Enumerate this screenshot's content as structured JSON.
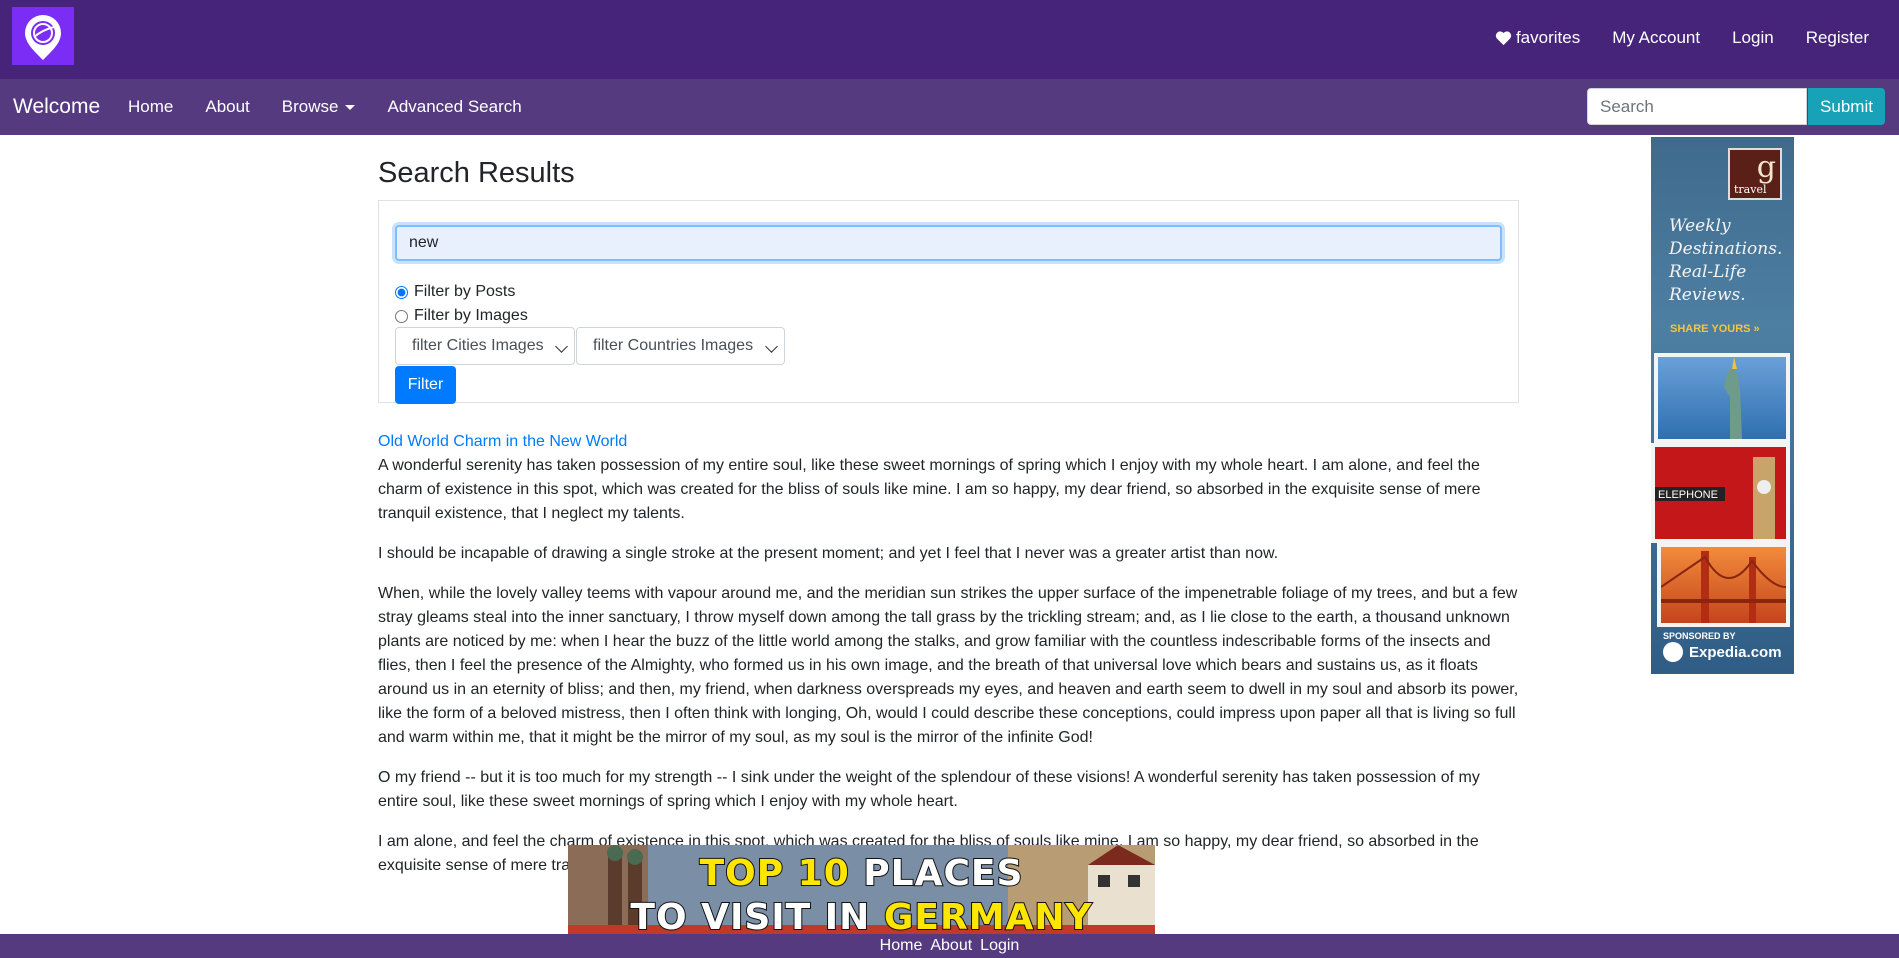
{
  "header": {
    "links": [
      {
        "label": "favorites",
        "icon": "heart-icon"
      },
      {
        "label": "My Account"
      },
      {
        "label": "Login"
      },
      {
        "label": "Register"
      }
    ]
  },
  "navbar": {
    "brand": "Welcome",
    "items": [
      "Home",
      "About",
      "Browse",
      "Advanced Search"
    ],
    "search_placeholder": "Search",
    "submit_label": "Submit"
  },
  "main": {
    "title": "Search Results",
    "query": "new",
    "filters": {
      "posts_label": "Filter by Posts",
      "images_label": "Filter by Images",
      "selected": "posts",
      "cities_select": "filter Cities Images",
      "countries_select": "filter Countries Images",
      "button": "Filter"
    },
    "result": {
      "title": "Old World Charm in the New World",
      "paragraphs": [
        "A wonderful serenity has taken possession of my entire soul, like these sweet mornings of spring which I enjoy with my whole heart. I am alone, and feel the charm of existence in this spot, which was created for the bliss of souls like mine. I am so happy, my dear friend, so absorbed in the exquisite sense of mere tranquil existence, that I neglect my talents.",
        "I should be incapable of drawing a single stroke at the present moment; and yet I feel that I never was a greater artist than now.",
        "When, while the lovely valley teems with vapour around me, and the meridian sun strikes the upper surface of the impenetrable foliage of my trees, and but a few stray gleams steal into the inner sanctuary, I throw myself down among the tall grass by the trickling stream; and, as I lie close to the earth, a thousand unknown plants are noticed by me: when I hear the buzz of the little world among the stalks, and grow familiar with the countless indescribable forms of the insects and flies, then I feel the presence of the Almighty, who formed us in his own image, and the breath of that universal love which bears and sustains us, as it floats around us in an eternity of bliss; and then, my friend, when darkness overspreads my eyes, and heaven and earth seem to dwell in my soul and absorb its power, like the form of a beloved mistress, then I often think with longing, Oh, would I could describe these conceptions, could impress upon paper all that is living so full and warm within me, that it might be the mirror of my soul, as my soul is the mirror of the infinite God!",
        "O my friend -- but it is too much for my strength -- I sink under the weight of the splendour of these visions! A wonderful serenity has taken possession of my entire soul, like these sweet mornings of spring which I enjoy with my whole heart.",
        "I am alone, and feel the charm of existence in this spot, which was created for the bliss of souls like mine. I am so happy, my dear friend, so absorbed in the exquisite sense of mere tranquil existence, that I neglect my talents."
      ]
    }
  },
  "ads": {
    "side": {
      "brand_letter": "g",
      "brand_word": "travel",
      "copy": "Weekly\nDestinations.\nReal-Life\nReviews.",
      "cta": "SHARE YOURS »",
      "sponsor_label": "SPONSORED BY",
      "sponsor": "Expedia.com"
    },
    "bottom": {
      "line1_a": "TOP 10",
      "line1_b": "PLACES",
      "line2_a": "TO VISIT IN",
      "line2_b": "GERMANY"
    }
  },
  "footer": {
    "links": [
      "Home",
      "About",
      "Login"
    ]
  },
  "colors": {
    "header_bg": "#46247a",
    "navbar_bg": "#553a80",
    "primary": "#007bff",
    "info": "#17a2b8"
  }
}
